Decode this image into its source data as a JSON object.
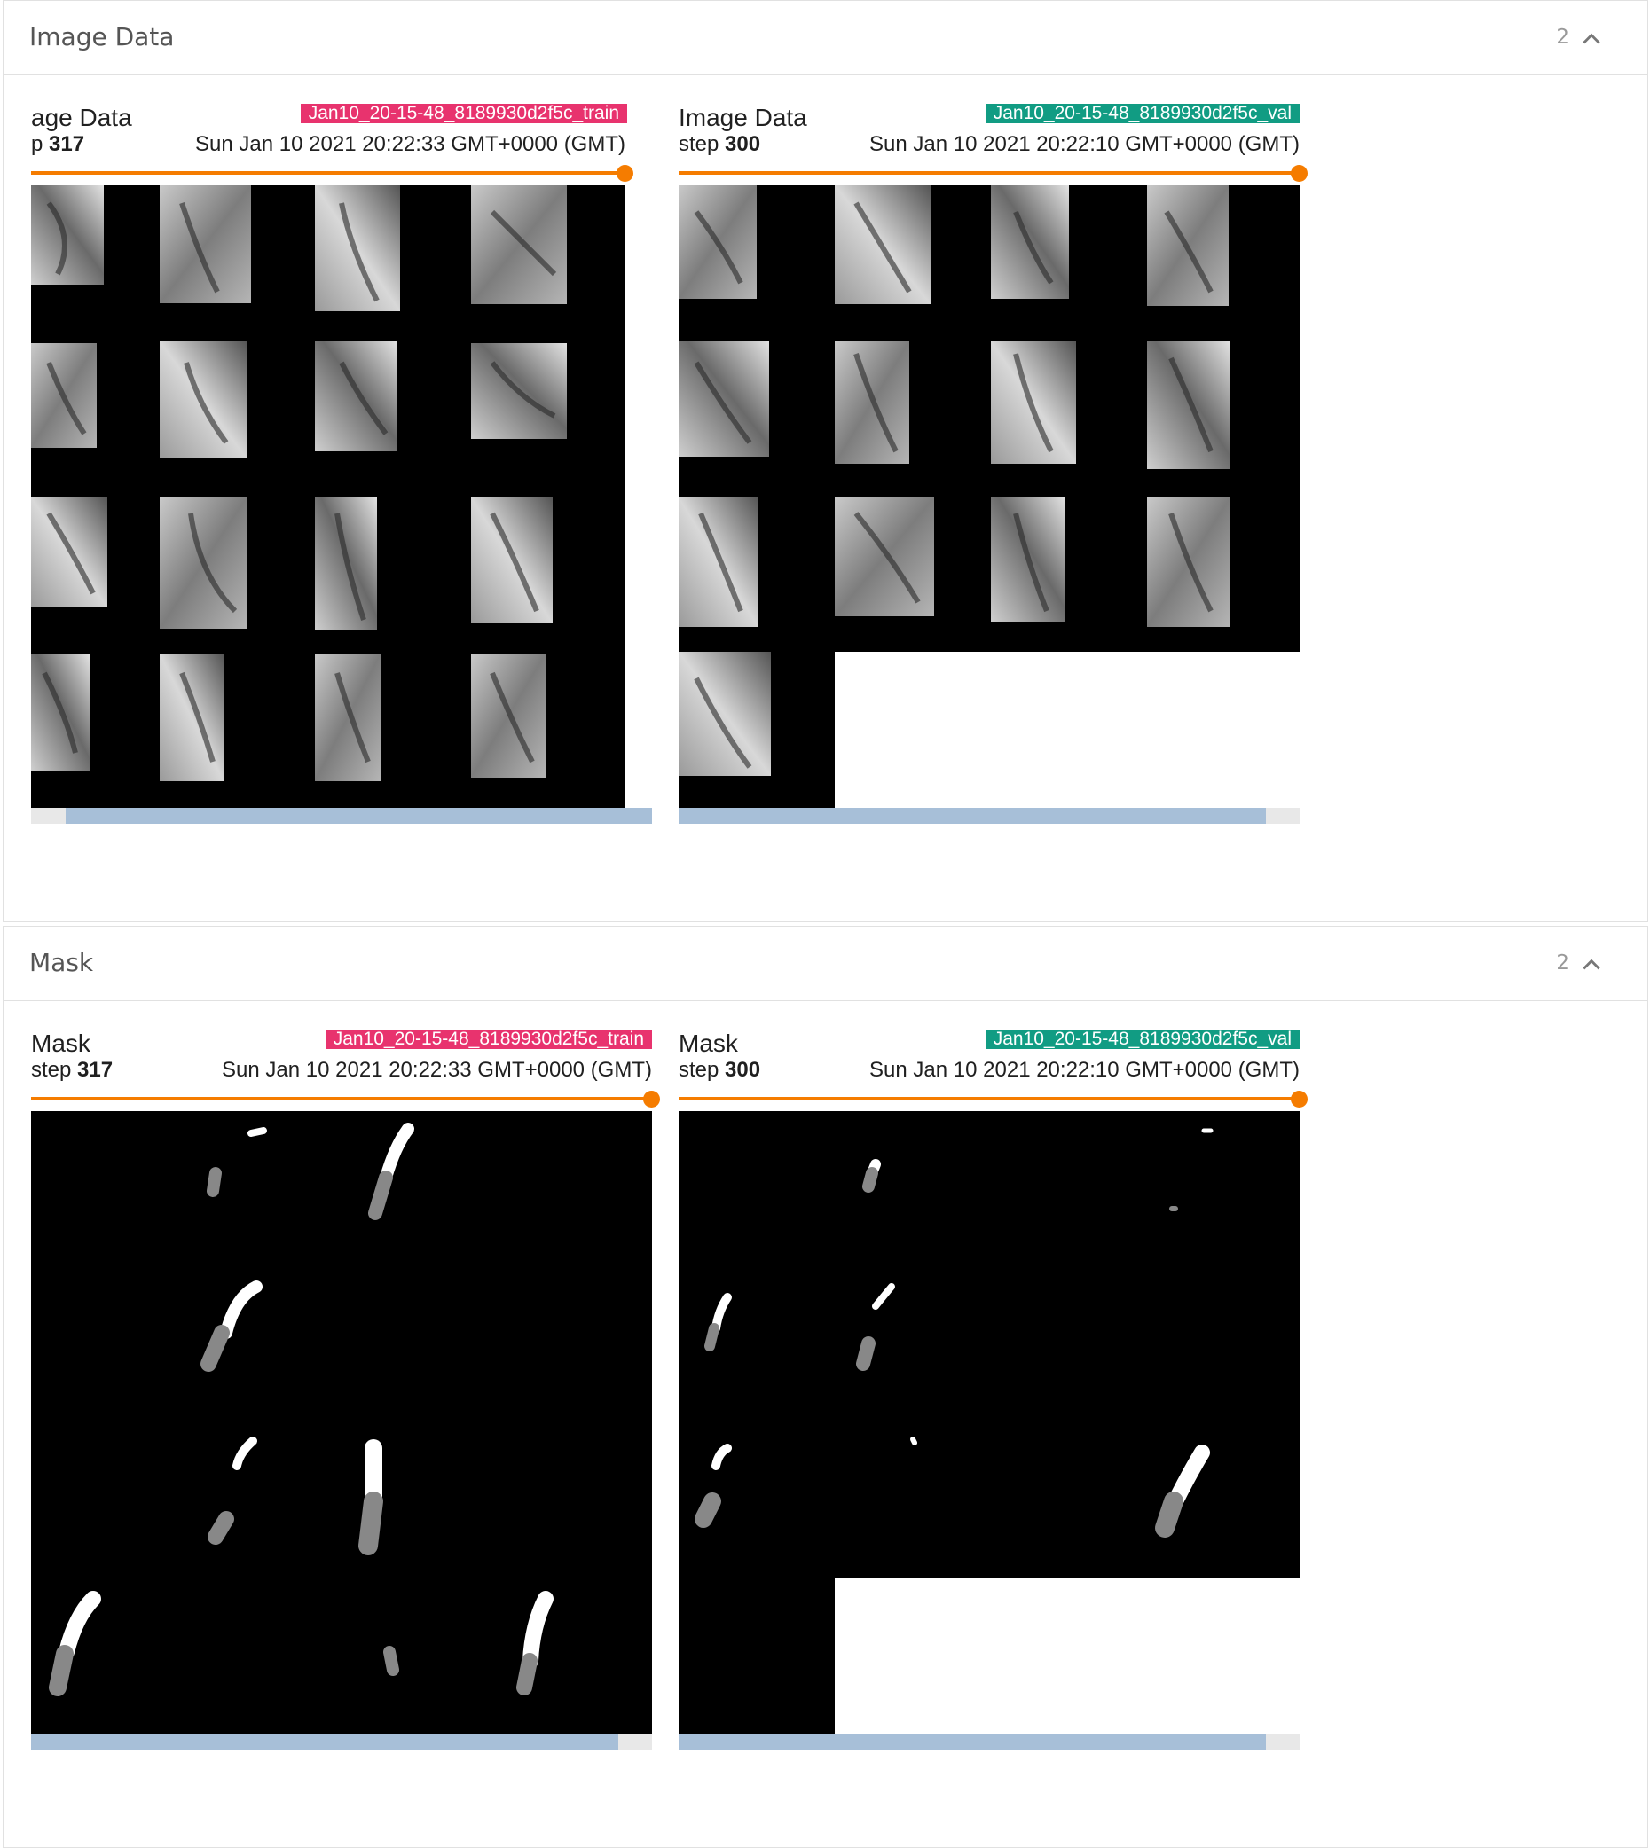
{
  "sections": [
    {
      "title": "Image Data",
      "count": "2",
      "cards": [
        {
          "title": "age Data",
          "step_prefix": "p",
          "step": "317",
          "run": "Jan10_20-15-48_8189930d2f5c_train",
          "time": "Sun Jan 10 2021 20:22:33 GMT+0000 (GMT)"
        },
        {
          "title": "Image Data",
          "step_prefix": "step",
          "step": "300",
          "run": "Jan10_20-15-48_8189930d2f5c_val",
          "time": "Sun Jan 10 2021 20:22:10 GMT+0000 (GMT)"
        }
      ]
    },
    {
      "title": "Mask",
      "count": "2",
      "cards": [
        {
          "title": "Mask",
          "step_prefix": "step",
          "step": "317",
          "run": "Jan10_20-15-48_8189930d2f5c_train",
          "time": "Sun Jan 10 2021 20:22:33 GMT+0000 (GMT)"
        },
        {
          "title": "Mask",
          "step_prefix": "step",
          "step": "300",
          "run": "Jan10_20-15-48_8189930d2f5c_val",
          "time": "Sun Jan 10 2021 20:22:10 GMT+0000 (GMT)"
        }
      ]
    }
  ],
  "colors": {
    "train_tag": "#e8336e",
    "val_tag": "#119c83",
    "slider": "#f57c00",
    "scrollbar_thumb": "#a7bfd8",
    "scrollbar_track": "#e8e8e8"
  },
  "icons": {
    "collapse": "chevron-up-icon"
  }
}
